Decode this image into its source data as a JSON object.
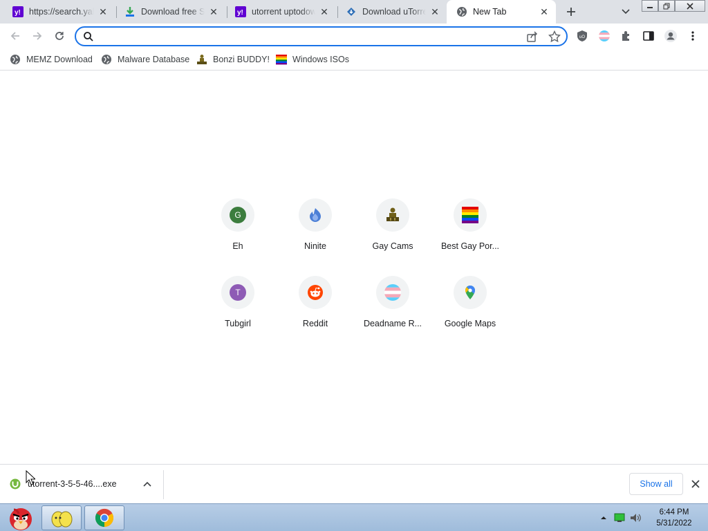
{
  "tabs": [
    {
      "title": "https://search.yahoo.com",
      "favicon": "yahoo-icon",
      "active": false
    },
    {
      "title": "Download free Stremio",
      "favicon": "download-arrow-icon",
      "active": false
    },
    {
      "title": "utorrent uptodown",
      "favicon": "yahoo-icon",
      "active": false
    },
    {
      "title": "Download uTorrent",
      "favicon": "uptodown-icon",
      "active": false
    },
    {
      "title": "New Tab",
      "favicon": "globe-icon",
      "active": true
    }
  ],
  "omnibox": {
    "value": "",
    "placeholder": ""
  },
  "bookmarks": [
    {
      "label": "MEMZ Download",
      "icon": "globe-icon"
    },
    {
      "label": "Malware Database",
      "icon": "globe-icon"
    },
    {
      "label": "Bonzi BUDDY!",
      "icon": "bonzi-icon"
    },
    {
      "label": "Windows ISOs",
      "icon": "rainbow-flag-icon"
    }
  ],
  "shortcuts": [
    {
      "label": "Eh",
      "icon": "letter-g-icon",
      "letter": "G",
      "color": "#3c7d3e"
    },
    {
      "label": "Ninite",
      "icon": "ninite-icon"
    },
    {
      "label": "Gay Cams",
      "icon": "bonzi-icon"
    },
    {
      "label": "Best Gay Por...",
      "icon": "rainbow-flag-icon"
    },
    {
      "label": "Tubgirl",
      "icon": "letter-t-icon",
      "letter": "T",
      "color": "#8e5bb5"
    },
    {
      "label": "Reddit",
      "icon": "reddit-icon"
    },
    {
      "label": "Deadname R...",
      "icon": "trans-flag-icon"
    },
    {
      "label": "Google Maps",
      "icon": "maps-pin-icon"
    }
  ],
  "download": {
    "filename": "utorrent-3-5-5-46....exe",
    "show_all": "Show all"
  },
  "taskbar": {
    "time": "6:44 PM",
    "date": "5/31/2022"
  },
  "colors": {
    "accent": "#1a73e8",
    "tabstrip": "#dee1e6",
    "taskbar": "#a9c3e0"
  }
}
